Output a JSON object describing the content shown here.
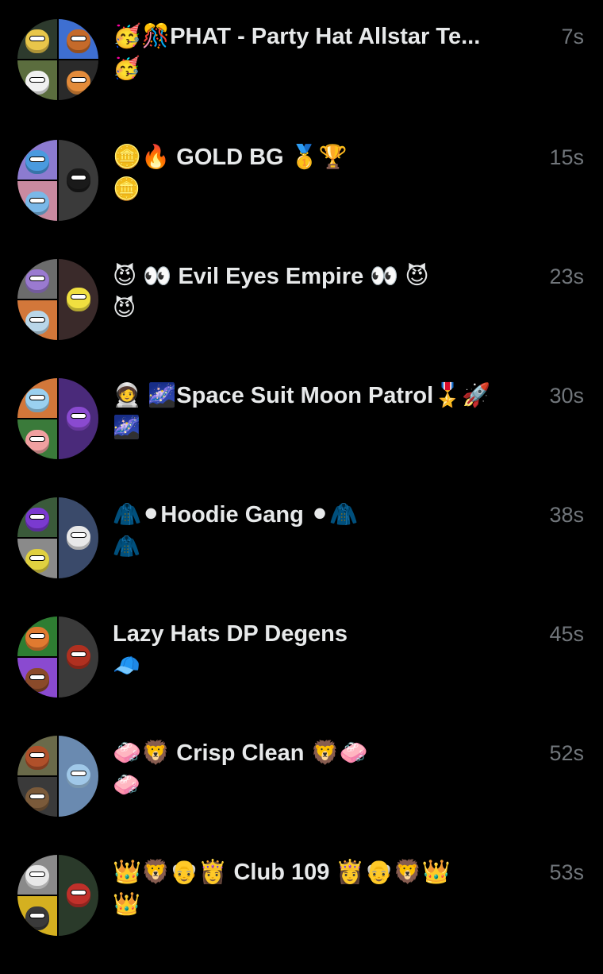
{
  "conversations": [
    {
      "title": "🥳🎊PHAT - Party Hat Allstar Te...",
      "extra": "🥳",
      "time": "7s",
      "avatar_colors": [
        "#2d3a2d",
        "#3e6fd1",
        "#5b6d3e",
        "#2a2a2a"
      ],
      "face_colors": [
        "#e8c64a",
        "#c56a2a",
        "#f0f0f0",
        "#e38b3a"
      ]
    },
    {
      "title": "🪙🔥 GOLD BG 🥇🏆",
      "extra": "🪙",
      "time": "15s",
      "avatar_colors": [
        "#8c7bd0",
        "#3a3a3a",
        "#c98aa0",
        "#2a2a2a"
      ],
      "face_colors": [
        "#4a9adf",
        "#1a1a1a",
        "#7ab8e8",
        "#1a1a1a"
      ]
    },
    {
      "title": "😈 👀 Evil Eyes Empire 👀 😈",
      "extra": "😈",
      "time": "23s",
      "avatar_colors": [
        "#6c6c6c",
        "#3a2a2a",
        "#d2773a",
        "#2a2a2a"
      ],
      "face_colors": [
        "#9a7ad0",
        "#f0e040",
        "#b9d6e8",
        "#f0e040"
      ]
    },
    {
      "title": "🧑‍🚀 🌌Space Suit Moon Patrol🎖️🚀",
      "extra": "🌌",
      "time": "30s",
      "avatar_colors": [
        "#d2773a",
        "#4a2a7a",
        "#3a7a3a",
        "#2a2a2a"
      ],
      "face_colors": [
        "#9ad0f0",
        "#8a4ad0",
        "#f0a0a0",
        "#8a4ad0"
      ]
    },
    {
      "title": "🧥⚫Hoodie Gang ⚫🧥",
      "extra": "🧥",
      "time": "38s",
      "avatar_colors": [
        "#3a5a3a",
        "#3a4a6a",
        "#8a8a8a",
        "#2a2a2a"
      ],
      "face_colors": [
        "#7a3ad0",
        "#e8e8e8",
        "#e0d040",
        "#e8e8e8"
      ]
    },
    {
      "title": "Lazy Hats DP Degens",
      "extra": "🧢",
      "time": "45s",
      "avatar_colors": [
        "#2e7d32",
        "#3a3a3a",
        "#8a4ad0",
        "#2a2a2a"
      ],
      "face_colors": [
        "#e07a30",
        "#b03020",
        "#8a4a2a",
        "#b03020"
      ]
    },
    {
      "title": "🧼🦁 Crisp Clean 🦁🧼",
      "extra": "🧼",
      "time": "52s",
      "avatar_colors": [
        "#6a6a4a",
        "#6a8ab0",
        "#3a3a3a",
        "#6a8ab0"
      ],
      "face_colors": [
        "#b0502a",
        "#a0c8e8",
        "#7a5a3a",
        "#a0c8e8"
      ]
    },
    {
      "title": "👑🦁👴👸 Club 109 👸👴🦁👑",
      "extra": "👑",
      "time": "53s",
      "avatar_colors": [
        "#8a8a8a",
        "#2a3a2a",
        "#d4b020",
        "#2a3a2a"
      ],
      "face_colors": [
        "#e8e8e8",
        "#c0302a",
        "#3a3a3a",
        "#c0302a"
      ]
    }
  ]
}
